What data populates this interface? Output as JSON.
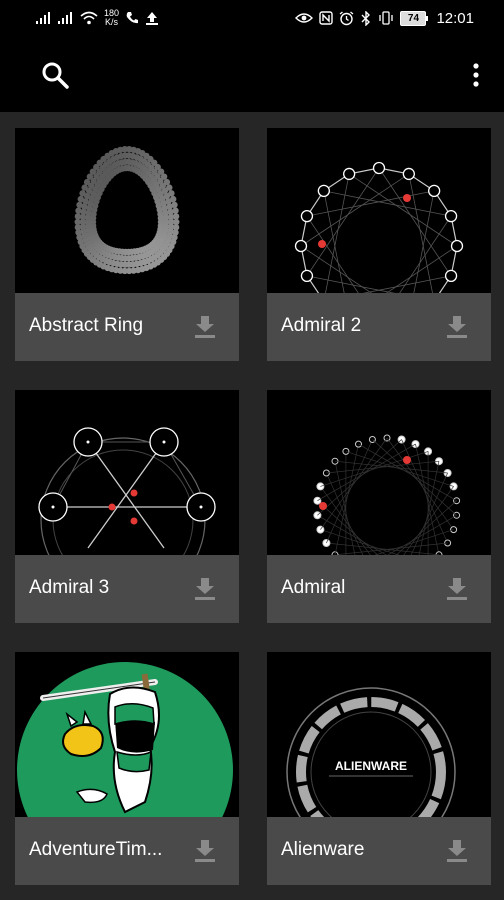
{
  "status_bar": {
    "speed_value": "180",
    "speed_unit": "K/s",
    "battery": "74",
    "time": "12:01"
  },
  "toolbar": {
    "search_icon": "search-icon",
    "menu_icon": "more-vert-icon"
  },
  "faces": [
    {
      "name": "Abstract Ring"
    },
    {
      "name": "Admiral 2"
    },
    {
      "name": "Admiral 3"
    },
    {
      "name": "Admiral"
    },
    {
      "name": "AdventureTim..."
    },
    {
      "name": "Alienware"
    }
  ],
  "alienware_text": "ALIENWARE",
  "colors": {
    "background": "#262626",
    "card_caption": "#4a4a4a",
    "accent_red": "#e53935",
    "adventure_green": "#1e9a5c"
  }
}
